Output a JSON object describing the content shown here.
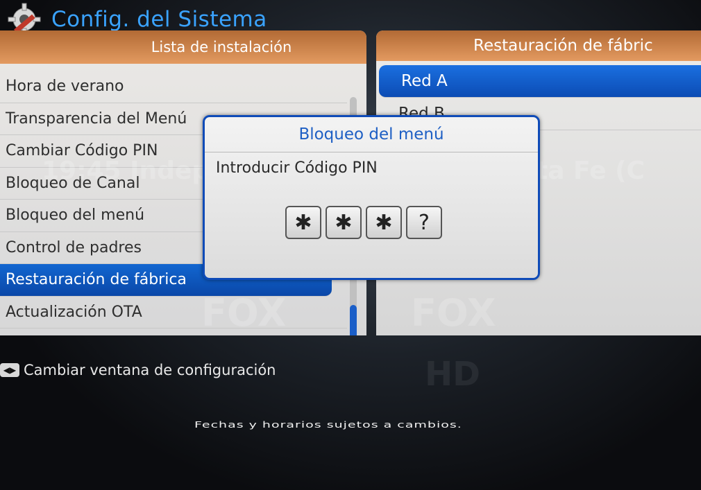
{
  "header": {
    "title": "Config. del Sistema",
    "icon": "tools-gear-icon"
  },
  "left_panel": {
    "title": "Lista de instalación",
    "items": [
      "Hora de verano",
      "Transparencia del Menú",
      "Cambiar Código PIN",
      "Bloqueo de Canal",
      "Bloqueo del menú",
      "Control de padres",
      "Restauración de fábrica",
      "Actualización OTA"
    ],
    "selected_index": 6
  },
  "right_panel": {
    "title": "Restauración de fábric",
    "items": [
      "Red A",
      "Red B"
    ],
    "selected_index": 0
  },
  "dialog": {
    "title": "Bloqueo del menú",
    "prompt": "Introducir Código PIN",
    "pin": [
      "✱",
      "✱",
      "✱",
      "?"
    ]
  },
  "background": {
    "watermark_score": "19:45 Independiente (ARG) vs. Santa Fe (C",
    "watermark_logo": "FOX",
    "watermark_hd": "HD"
  },
  "footer": {
    "hint": "Cambiar ventana de configuración",
    "ticker": "Fechas y horarios sujetos a cambios."
  },
  "colors": {
    "accent_blue": "#1266d0",
    "header_orange": "#d9874a",
    "title_blue": "#3aa3ff"
  }
}
